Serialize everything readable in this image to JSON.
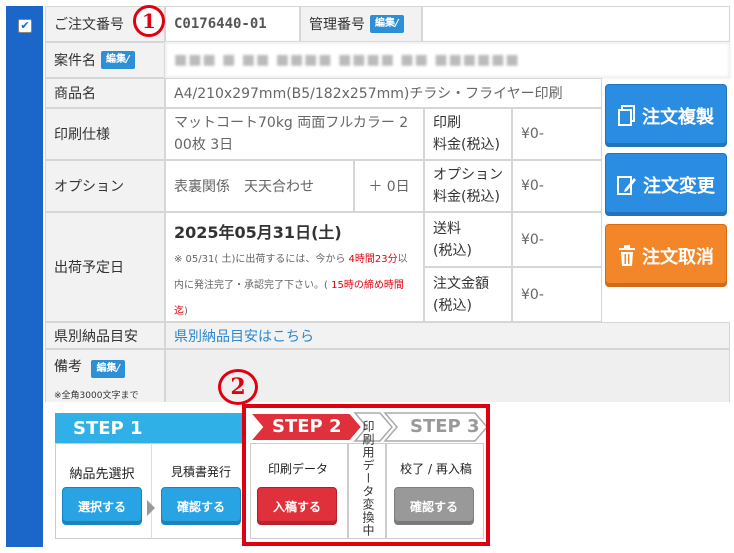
{
  "order": {
    "order_no_label": "ご注文番号",
    "order_no": "C0176440-01",
    "mgmt_label": "管理番号",
    "edit_label": "編集",
    "project_label": "案件名",
    "project_value": "■■■ ■ ■■ ■■■■ ■■■■ ■■ ■■■■■■",
    "product_label": "商品名",
    "product_value": "A4/210x297mm(B5/182x257mm)チラシ・フライヤー印刷",
    "spec_label": "印刷仕様",
    "spec_value_1": "マットコート70kg 両面フルカラー 2",
    "spec_value_2": "00枚 3日",
    "print_fee_label_1": "印刷",
    "print_fee_label_2": "料金(税込)",
    "print_fee": "¥0-",
    "option_label": "オプション",
    "option_value": "表裏関係　天天合わせ",
    "option_days": "＋ 0日",
    "option_fee_label_1": "オプション",
    "option_fee_label_2": "料金(税込)",
    "option_fee": "¥0-",
    "ship_label": "出荷予定日",
    "ship_date": "2025年05月31日(土)",
    "ship_note_1a": "※ 05/31( 土)に出荷するには、今から ",
    "ship_note_1b": "4時間23分",
    "ship_note_1c": "以",
    "ship_note_2a": "内に発注完了・承認完了下さい。( ",
    "ship_note_2b": "15時の締め時間",
    "ship_note_3a": "迄",
    "ship_note_3b": ")",
    "postage_label_1": "送料",
    "postage_label_2": "(税込)",
    "postage_fee": "¥0-",
    "total_label_1": "注文金額",
    "total_label_2": "(税込)",
    "total_fee": "¥0-",
    "pref_label": "県別納品目安",
    "pref_link": "県別納品目安はこちら",
    "memo_label": "備考",
    "memo_note": "※全角3000文字まで"
  },
  "side_buttons": {
    "copy": "注文複製",
    "change": "注文変更",
    "cancel": "注文取消"
  },
  "markers": {
    "one": "1",
    "two": "2"
  },
  "steps": {
    "step1": "STEP 1",
    "step2": "STEP 2",
    "step3": "STEP 3",
    "dest_label": "納品先選択",
    "dest_btn": "選択する",
    "estimate_label": "見積書発行",
    "estimate_btn": "確認する",
    "data_label": "印刷データ",
    "data_btn": "入稿する",
    "converting": "印刷用データ変換中",
    "proof_label": "校了 / 再入稿",
    "proof_btn": "確認する"
  },
  "colors": {
    "sidebar": "#1b66c9",
    "accent_blue": "#2a8de2",
    "accent_orange": "#f4862a",
    "highlight_red": "#e00010"
  }
}
